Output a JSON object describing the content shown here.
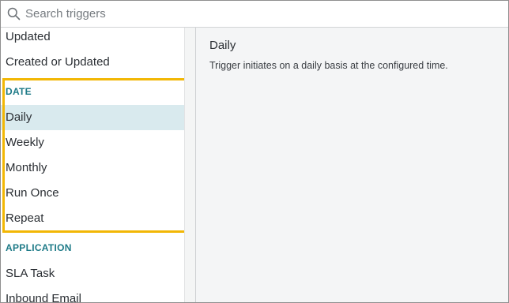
{
  "search": {
    "placeholder": "Search triggers",
    "value": ""
  },
  "trigger_list": {
    "top_items": [
      "Updated",
      "Created or Updated"
    ],
    "sections": [
      {
        "header": "DATE",
        "items": [
          "Daily",
          "Weekly",
          "Monthly",
          "Run Once",
          "Repeat"
        ]
      },
      {
        "header": "APPLICATION",
        "items": [
          "SLA Task",
          "Inbound Email"
        ]
      }
    ],
    "selected": "Daily"
  },
  "detail": {
    "title": "Daily",
    "description": "Trigger initiates on a daily basis at the configured time."
  },
  "colors": {
    "section_header": "#1d7a87",
    "selected_row": "#d9eaee",
    "highlight_outline": "#f2b705",
    "detail_background": "#f4f5f6"
  }
}
